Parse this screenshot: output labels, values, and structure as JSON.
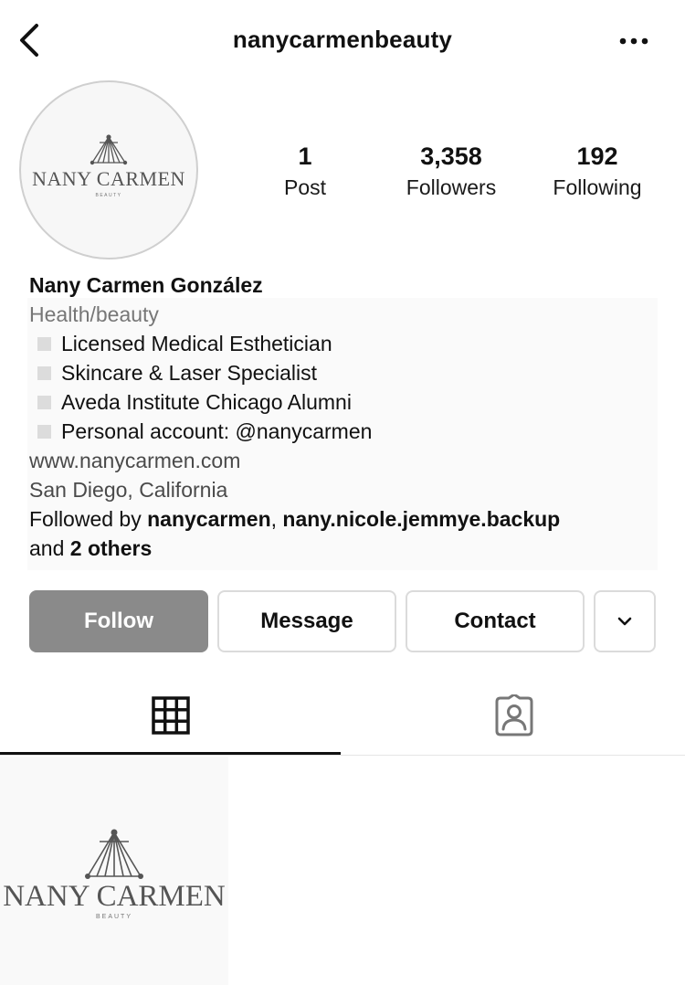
{
  "header": {
    "username": "nanycarmenbeauty",
    "back_icon": "chevron-left-icon",
    "more_icon": "more-horizontal-icon"
  },
  "profile": {
    "avatar_logo": {
      "brand": "NANY CARMEN",
      "sub": "BEAUTY"
    },
    "stats": [
      {
        "count": "1",
        "label": "Post"
      },
      {
        "count": "3,358",
        "label": "Followers"
      },
      {
        "count": "192",
        "label": "Following"
      }
    ]
  },
  "bio": {
    "name": "Nany Carmen González",
    "category": "Health/beauty",
    "lines": [
      "Licensed Medical Esthetician",
      "Skincare & Laser Specialist",
      "Aveda Institute Chicago Alumni",
      "Personal account: @nanycarmen"
    ],
    "website": "www.nanycarmen.com",
    "location": "San Diego, California",
    "followed_by": {
      "prefix": "Followed by ",
      "user1": "nanycarmen",
      "separator": ", ",
      "user2": "nany.nicole.jemmye.backup",
      "and_text": "and ",
      "others": "2 others"
    }
  },
  "actions": {
    "follow": "Follow",
    "message": "Message",
    "contact": "Contact",
    "more_icon": "chevron-down-icon"
  },
  "tabs": {
    "grid_icon": "grid-icon",
    "tagged_icon": "tagged-person-icon",
    "active": "grid"
  },
  "posts": [
    {
      "brand": "NANY CARMEN",
      "sub": "BEAUTY"
    }
  ],
  "colors": {
    "follow_button": "#8a8a8a",
    "text": "#111111",
    "muted": "#777777",
    "border": "#dbdbdb"
  }
}
